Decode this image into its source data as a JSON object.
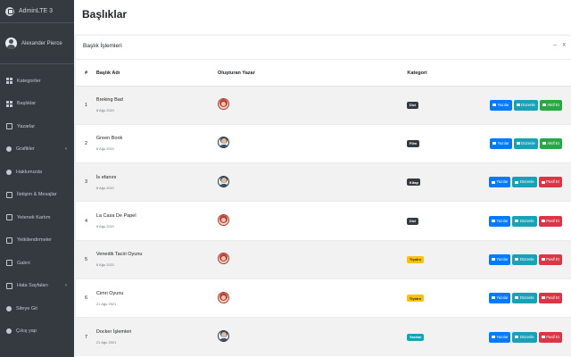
{
  "app": {
    "brand": "AdminLTE 3",
    "user_name": "Alexander Pierce"
  },
  "colors": {
    "sidebar": "#343a40",
    "primary": "#007bff",
    "info": "#17a2b8",
    "success": "#28a745",
    "danger": "#dc3545",
    "warning": "#ffc107",
    "dark": "#343a40"
  },
  "sidebar": {
    "items": [
      {
        "label": "Kategoriler",
        "icon": "home-icon"
      },
      {
        "label": "Başlıklar",
        "icon": "grid-icon"
      },
      {
        "label": "Yazarlar",
        "icon": "users-icon"
      },
      {
        "label": "Grafikler",
        "icon": "chart-icon",
        "caret": "‹"
      },
      {
        "label": "Hakkımızda",
        "icon": "info-icon"
      },
      {
        "label": "İletişim & Mesajlar",
        "icon": "edit-icon"
      },
      {
        "label": "Yetenek Kartım",
        "icon": "card-icon"
      },
      {
        "label": "Yetkilendirmeler",
        "icon": "key-icon"
      },
      {
        "label": "Galeri",
        "icon": "image-icon"
      },
      {
        "label": "Hata Sayfaları",
        "icon": "warning-icon",
        "caret": "‹"
      },
      {
        "label": "Siteye Git",
        "icon": "globe-icon"
      },
      {
        "label": "Çıkış yap",
        "icon": "logout-icon"
      }
    ]
  },
  "header": {
    "title": "Başlıklar"
  },
  "card": {
    "title": "Başlık İşlemleri",
    "minimize": "–",
    "close": "x"
  },
  "table": {
    "columns": [
      "#",
      "Başlık Adı",
      "Oluşturan Yazar",
      "Kategori",
      ""
    ],
    "rows": [
      {
        "num": "1",
        "name": "Breking Bad",
        "date": "8 Ağu 2021",
        "author_avatar": "female",
        "category": "Dizi",
        "category_style": "dark",
        "buttons": [
          {
            "label": "Yazılar",
            "style": "primary"
          },
          {
            "label": "Düzenle",
            "style": "info"
          },
          {
            "label": "Aktif Et",
            "style": "success"
          }
        ]
      },
      {
        "num": "2",
        "name": "Green Book",
        "date": "8 Ağu 2021",
        "author_avatar": "male",
        "category": "Film",
        "category_style": "dark",
        "buttons": [
          {
            "label": "Yazılar",
            "style": "primary"
          },
          {
            "label": "Düzenle",
            "style": "info"
          },
          {
            "label": "Aktif Et",
            "style": "success"
          }
        ]
      },
      {
        "num": "3",
        "name": "İs efanını",
        "date": "8 Ağu 2021",
        "author_avatar": "male",
        "category": "Kitap",
        "category_style": "dark",
        "buttons": [
          {
            "label": "Yazılar",
            "style": "primary"
          },
          {
            "label": "Düzenle",
            "style": "info"
          },
          {
            "label": "Pasif Et",
            "style": "danger"
          }
        ]
      },
      {
        "num": "4",
        "name": "La Casa De Papel",
        "date": "8 Ağu 2021",
        "author_avatar": "female",
        "category": "Dizi",
        "category_style": "dark",
        "buttons": [
          {
            "label": "Yazılar",
            "style": "primary"
          },
          {
            "label": "Düzenle",
            "style": "info"
          },
          {
            "label": "Pasif Et",
            "style": "danger"
          }
        ]
      },
      {
        "num": "5",
        "name": "Venedik Taciri Oyunu",
        "date": "8 Ağu 2021",
        "author_avatar": "female",
        "category": "Tiyatro",
        "category_style": "warning",
        "buttons": [
          {
            "label": "Yazılar",
            "style": "primary"
          },
          {
            "label": "Düzenle",
            "style": "info"
          },
          {
            "label": "Pasif Et",
            "style": "danger"
          }
        ]
      },
      {
        "num": "6",
        "name": "Cimri Oyunu",
        "date": "21 Ağu 2021",
        "author_avatar": "female",
        "category": "Tiyatro",
        "category_style": "warning",
        "buttons": [
          {
            "label": "Yazılar",
            "style": "primary"
          },
          {
            "label": "Düzenle",
            "style": "info"
          },
          {
            "label": "Pasif Et",
            "style": "danger"
          }
        ]
      },
      {
        "num": "7",
        "name": "Docker İşlemleri",
        "date": "21 Ağu 2021",
        "author_avatar": "male",
        "category": "Yazılım",
        "category_style": "info",
        "buttons": [
          {
            "label": "Yazılar",
            "style": "primary"
          },
          {
            "label": "Düzenle",
            "style": "info"
          },
          {
            "label": "Pasif Et",
            "style": "danger"
          }
        ]
      }
    ]
  }
}
